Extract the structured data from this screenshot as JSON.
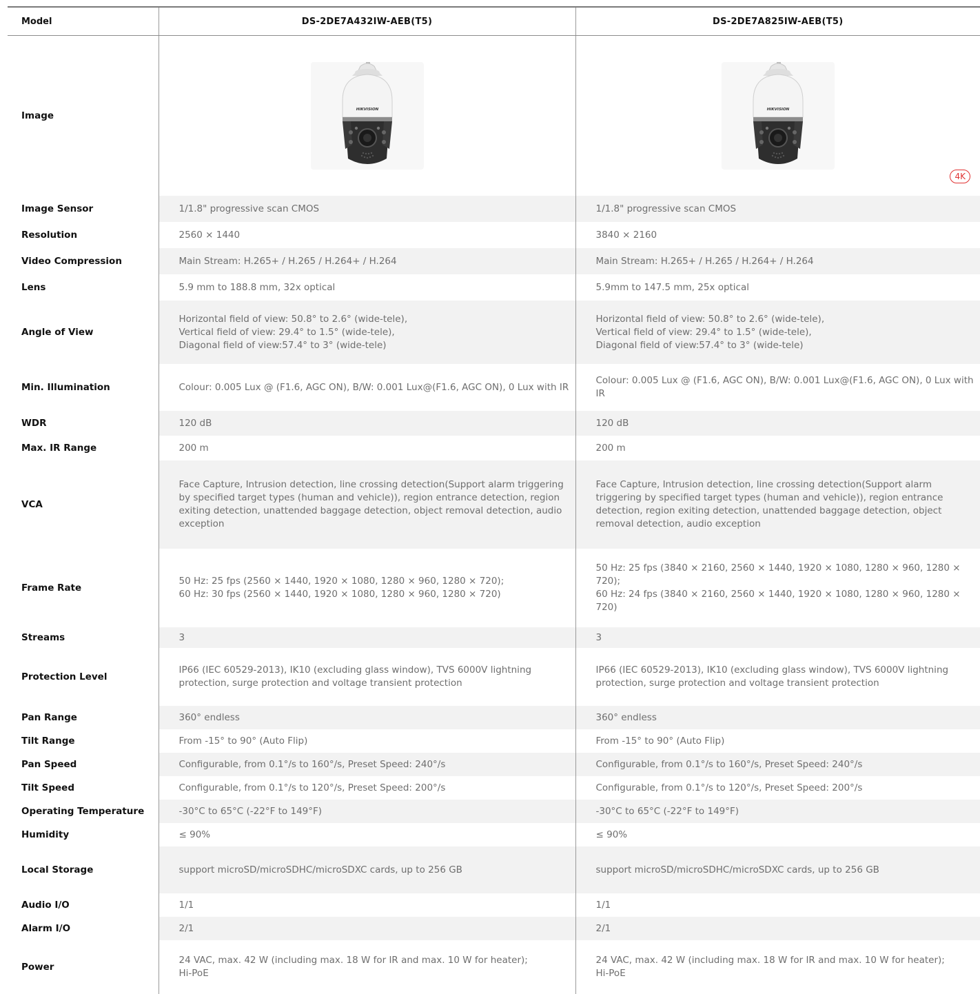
{
  "header": {
    "label": "Model",
    "model_a": "DS-2DE7A432IW-AEB(T5)",
    "model_b": "DS-2DE7A825IW-AEB(T5)"
  },
  "image_row": {
    "label": "Image",
    "brand_a": "HIKVISION",
    "brand_b": "HIKVISION",
    "badge_b": "4K"
  },
  "specs": [
    {
      "label": "Image Sensor",
      "a": "1/1.8\" progressive scan CMOS",
      "b": "1/1.8\" progressive scan CMOS"
    },
    {
      "label": "Resolution",
      "a": "2560 × 1440",
      "b": "3840 × 2160"
    },
    {
      "label": "Video Compression",
      "a": "Main Stream: H.265+ / H.265 / H.264+ / H.264",
      "b": "Main Stream: H.265+ / H.265 / H.264+ / H.264"
    },
    {
      "label": "Lens",
      "a": "5.9 mm to 188.8 mm, 32x optical",
      "b": "5.9mm to 147.5 mm, 25x optical"
    },
    {
      "label": "Angle of View",
      "a": "Horizontal field of view: 50.8° to 2.6° (wide-tele),\nVertical field of view: 29.4° to 1.5° (wide-tele),\nDiagonal field of view:57.4° to 3° (wide-tele)",
      "b": "Horizontal field of view: 50.8° to 2.6° (wide-tele),\nVertical field of view: 29.4° to 1.5° (wide-tele),\nDiagonal field of view:57.4° to 3° (wide-tele)"
    },
    {
      "label": "Min. Illumination",
      "a": "Colour: 0.005 Lux @ (F1.6, AGC ON), B/W: 0.001 Lux@(F1.6, AGC ON), 0 Lux with IR",
      "b": "Colour: 0.005 Lux @ (F1.6, AGC ON), B/W: 0.001 Lux@(F1.6, AGC ON), 0 Lux with IR"
    },
    {
      "label": "WDR",
      "a": "120 dB",
      "b": "120 dB"
    },
    {
      "label": "Max. IR Range",
      "a": "200 m",
      "b": "200 m"
    },
    {
      "label": "VCA",
      "a": "Face Capture, Intrusion detection, line crossing detection(Support alarm triggering by specified target types (human and vehicle)), region entrance detection, region exiting detection, unattended baggage detection, object removal detection, audio exception",
      "b": "Face Capture, Intrusion detection, line crossing detection(Support alarm triggering by specified target types (human and vehicle)), region entrance detection, region exiting detection, unattended baggage detection, object removal detection, audio exception"
    },
    {
      "label": "Frame Rate",
      "a": "50 Hz: 25 fps (2560 × 1440, 1920 × 1080, 1280 × 960, 1280 × 720);\n60 Hz: 30 fps (2560 × 1440, 1920 × 1080, 1280 × 960, 1280 × 720)",
      "b": "50 Hz: 25 fps (3840 × 2160, 2560 × 1440, 1920 × 1080, 1280 × 960, 1280 × 720);\n60 Hz: 24 fps (3840 × 2160, 2560 × 1440, 1920 × 1080, 1280 × 960, 1280 × 720)"
    },
    {
      "label": "Streams",
      "a": "3",
      "b": "3"
    },
    {
      "label": "Protection Level",
      "a": "IP66 (IEC 60529-2013), IK10 (excluding glass window), TVS 6000V lightning protection, surge protection and voltage transient protection",
      "b": "IP66 (IEC 60529-2013), IK10 (excluding glass window), TVS 6000V lightning protection, surge protection and voltage transient protection"
    },
    {
      "label": "Pan Range",
      "a": "360° endless",
      "b": "360° endless"
    },
    {
      "label": "Tilt Range",
      "a": "From -15° to 90° (Auto Flip)",
      "b": "From -15° to 90° (Auto Flip)"
    },
    {
      "label": "Pan Speed",
      "a": "Configurable, from 0.1°/s to 160°/s, Preset Speed: 240°/s",
      "b": "Configurable, from 0.1°/s to 160°/s, Preset Speed: 240°/s"
    },
    {
      "label": "Tilt Speed",
      "a": "Configurable, from 0.1°/s to 120°/s, Preset Speed: 200°/s",
      "b": "Configurable, from 0.1°/s to 120°/s, Preset Speed: 200°/s"
    },
    {
      "label": "Operating Temperature",
      "a": "-30°C to 65°C (-22°F to 149°F)",
      "b": "-30°C to 65°C (-22°F to 149°F)"
    },
    {
      "label": "Humidity",
      "a": "≤ 90%",
      "b": "≤ 90%"
    },
    {
      "label": "Local Storage",
      "a": "support microSD/microSDHC/microSDXC cards, up to 256 GB",
      "b": "support microSD/microSDHC/microSDXC cards, up to 256 GB"
    },
    {
      "label": "Audio I/O",
      "a": "1/1",
      "b": "1/1"
    },
    {
      "label": "Alarm I/O",
      "a": "2/1",
      "b": "2/1"
    },
    {
      "label": "Power",
      "a": "24 VAC, max. 42 W (including max. 18 W for IR and max. 10 W for heater);\nHi-PoE",
      "b": "24 VAC, max. 42 W (including max. 18 W for IR and max. 10 W for heater);\nHi-PoE"
    }
  ]
}
